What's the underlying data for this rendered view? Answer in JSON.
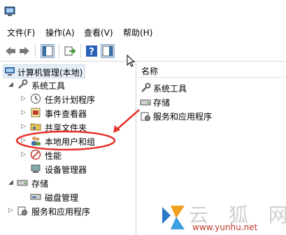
{
  "menu": {
    "items": [
      "文件(F)",
      "操作(A)",
      "查看(V)",
      "帮助(H)"
    ]
  },
  "toolbar": {
    "buttons": [
      "back-icon",
      "forward-icon",
      "show-console-tree-icon",
      "export-list-icon",
      "help-icon",
      "show-action-pane-icon"
    ]
  },
  "tree": {
    "root": "计算机管理(本地)",
    "system_tools": "系统工具",
    "task_scheduler": "任务计划程序",
    "event_viewer": "事件查看器",
    "shared_folders": "共享文件夹",
    "local_users_groups": "本地用户和组",
    "performance": "性能",
    "device_manager": "设备管理器",
    "storage": "存储",
    "disk_management": "磁盘管理",
    "services_apps": "服务和应用程序"
  },
  "list": {
    "column_name": "名称",
    "rows": [
      "系统工具",
      "存储",
      "服务和应用程序"
    ]
  },
  "annotation": {
    "color": "#e8302a"
  },
  "watermark": {
    "brand": "云 狐 网",
    "url": "www.yunhu.net"
  }
}
